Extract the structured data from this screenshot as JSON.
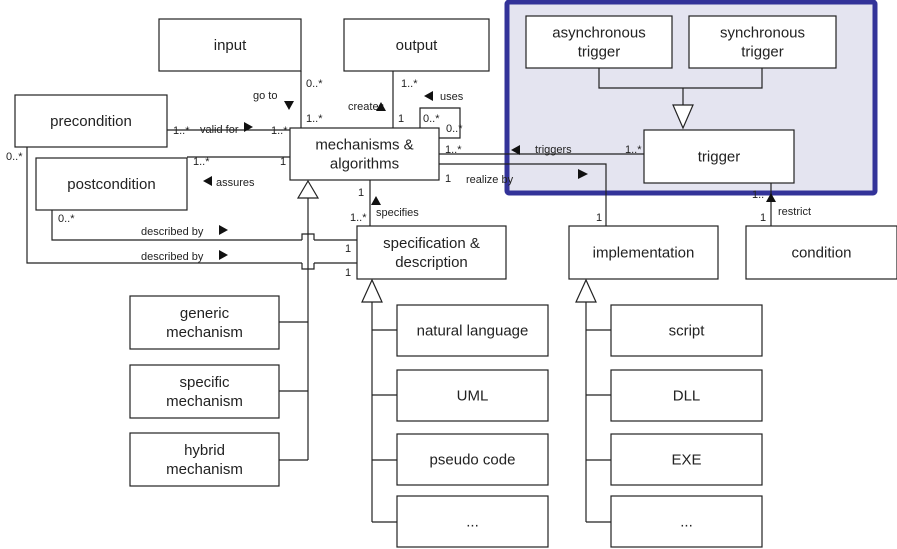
{
  "highlight": {
    "fill": "#e4e4f0",
    "border": "#333399"
  },
  "classes": {
    "input": [
      "input"
    ],
    "output": [
      "output"
    ],
    "precondition": [
      "precondition"
    ],
    "postcondition": [
      "postcondition"
    ],
    "mechanisms": [
      "mechanisms &",
      "algorithms"
    ],
    "specification": [
      "specification &",
      "description"
    ],
    "implementation": [
      "implementation"
    ],
    "condition": [
      "condition"
    ],
    "async_trigger": [
      "asynchronous",
      "trigger"
    ],
    "sync_trigger": [
      "synchronous",
      "trigger"
    ],
    "trigger": [
      "trigger"
    ],
    "generic": [
      "generic",
      "mechanism"
    ],
    "specific": [
      "specific",
      "mechanism"
    ],
    "hybrid": [
      "hybrid",
      "mechanism"
    ],
    "spec_children": [
      "natural language",
      "UML",
      "pseudo code",
      "..."
    ],
    "impl_children": [
      "script",
      "DLL",
      "EXE",
      "..."
    ]
  },
  "associations": {
    "go_to": "go to",
    "creates": "creates",
    "uses": "uses",
    "valid_for": "valid for",
    "assures": "assures",
    "specifies": "specifies",
    "triggers": "triggers",
    "realize_by": "realize by",
    "restrict": "restrict",
    "described_by_1": "described by",
    "described_by_2": "described by"
  },
  "multiplicities": {
    "input_m": "0..*",
    "mech_input": "1..*",
    "output_m": "1..*",
    "mech_output": "1",
    "uses_a": "0..*",
    "uses_b": "0..*",
    "pre_m": "1..*",
    "mech_pre": "1..*",
    "post_m": "1..*",
    "mech_post": "1",
    "mech_trig": "1..*",
    "trig_m": "1..*",
    "mech_real": "1",
    "impl_m": "1",
    "mech_spec": "1",
    "spec_m": "1..*",
    "post_desc": "0..*",
    "pre_desc": "0..*",
    "spec_d1": "1",
    "spec_d2": "1",
    "trig_cond": "1..",
    "cond_m": "1"
  }
}
